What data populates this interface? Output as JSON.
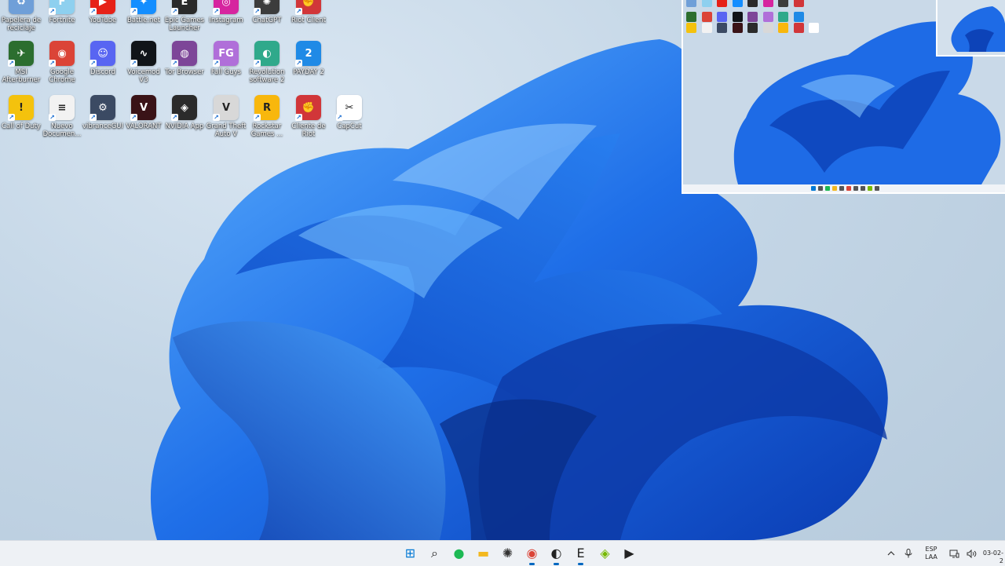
{
  "desktop": {
    "icons": [
      {
        "label": "Papelera de reciclaje",
        "icon": "recycle-bin-icon",
        "color": "#6f9fd8",
        "glyph": "♻"
      },
      {
        "label": "Fortnite",
        "icon": "fortnite-icon",
        "color": "#8ed0ef",
        "glyph": "F"
      },
      {
        "label": "YouTube",
        "icon": "youtube-icon",
        "color": "#e62117",
        "glyph": "▶"
      },
      {
        "label": "Battle.net",
        "icon": "battlenet-icon",
        "color": "#148eff",
        "glyph": "✦"
      },
      {
        "label": "Epic Games Launcher",
        "icon": "epic-games-icon",
        "color": "#2a2a2a",
        "glyph": "E"
      },
      {
        "label": "Instagram",
        "icon": "instagram-icon",
        "color": "#d6249f",
        "glyph": "◎"
      },
      {
        "label": "ChatGPT",
        "icon": "chatgpt-icon",
        "color": "#3c3c3c",
        "glyph": "✺"
      },
      {
        "label": "Riot Client",
        "icon": "riot-client-icon",
        "color": "#d13639",
        "glyph": "✊"
      },
      {
        "label": "MSI Afterburner",
        "icon": "msi-afterburner-icon",
        "color": "#2c6e2f",
        "glyph": "✈"
      },
      {
        "label": "Google Chrome",
        "icon": "chrome-icon",
        "color": "#db4437",
        "glyph": "◉"
      },
      {
        "label": "Discord",
        "icon": "discord-icon",
        "color": "#5865f2",
        "glyph": "☺"
      },
      {
        "label": "Voicemod V3",
        "icon": "voicemod-icon",
        "color": "#101418",
        "glyph": "∿"
      },
      {
        "label": "Tor Browser",
        "icon": "tor-browser-icon",
        "color": "#7d4698",
        "glyph": "◍"
      },
      {
        "label": "Fall Guys",
        "icon": "fall-guys-icon",
        "color": "#b06fd9",
        "glyph": "FG"
      },
      {
        "label": "Revolution software 2",
        "icon": "revolution-software-icon",
        "color": "#2fa98b",
        "glyph": "◐"
      },
      {
        "label": "PAYDAY 2",
        "icon": "payday2-icon",
        "color": "#1f8ae6",
        "glyph": "2"
      },
      {
        "label": "Call of Duty",
        "icon": "warning-icon",
        "color": "#f4c20d",
        "glyph": "!"
      },
      {
        "label": "Nuevo Documen...",
        "icon": "document-icon",
        "color": "#f2f2f2",
        "glyph": "≡"
      },
      {
        "label": "vibranceGUI",
        "icon": "vibrance-gear-icon",
        "color": "#3b4a63",
        "glyph": "⚙"
      },
      {
        "label": "VALORANT",
        "icon": "valorant-icon",
        "color": "#3a1317",
        "glyph": "V"
      },
      {
        "label": "NVIDIA App",
        "icon": "nvidia-icon",
        "color": "#2b2b2b",
        "glyph": "◈"
      },
      {
        "label": "Grand Theft Auto V",
        "icon": "gta5-icon",
        "color": "#d8d8d8",
        "glyph": "V"
      },
      {
        "label": "Rockstar Games ...",
        "icon": "rockstar-icon",
        "color": "#f8b70d",
        "glyph": "R"
      },
      {
        "label": "Cliente de Riot",
        "icon": "riot-client-icon",
        "color": "#d13639",
        "glyph": "✊"
      },
      {
        "label": "CapCut",
        "icon": "capcut-icon",
        "color": "#ffffff",
        "glyph": "✂"
      }
    ]
  },
  "taskbar": {
    "items": [
      {
        "name": "start-button",
        "glyph": "⊞",
        "color": "#0078d4"
      },
      {
        "name": "search-button",
        "glyph": "⌕",
        "color": "#222222"
      },
      {
        "name": "spotify-button",
        "glyph": "●",
        "color": "#1db954"
      },
      {
        "name": "file-explorer-button",
        "glyph": "▬",
        "color": "#f3b81f"
      },
      {
        "name": "chatgpt-taskbar-button",
        "glyph": "✺",
        "color": "#333333"
      },
      {
        "name": "chrome-taskbar-button",
        "glyph": "◉",
        "color": "#db4437"
      },
      {
        "name": "obs-taskbar-button",
        "glyph": "◐",
        "color": "#222222"
      },
      {
        "name": "epic-games-taskbar-button",
        "glyph": "E",
        "color": "#222222"
      },
      {
        "name": "nvidia-taskbar-button",
        "glyph": "◈",
        "color": "#76b900"
      },
      {
        "name": "media-player-button",
        "glyph": "▶",
        "color": "#222222"
      }
    ],
    "tray": {
      "lang_line1": "ESP",
      "lang_line2": "LAA",
      "date": "03-02-2"
    }
  }
}
